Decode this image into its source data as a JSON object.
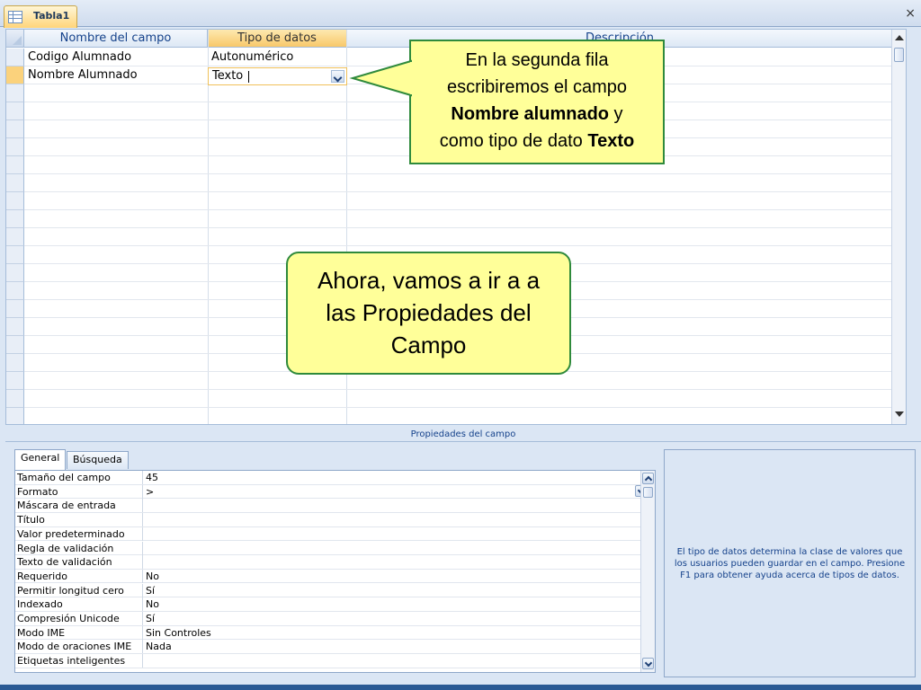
{
  "tab": {
    "label": "Tabla1",
    "close": "×",
    "icon": "table-icon"
  },
  "grid": {
    "headers": [
      "Nombre del campo",
      "Tipo de datos",
      "Descripción"
    ],
    "rows": [
      {
        "name": "Codigo Alumnado",
        "type": "Autonumérico",
        "desc": ""
      },
      {
        "name": "Nombre Alumnado",
        "type": "Texto",
        "desc": ""
      }
    ]
  },
  "callouts": {
    "top": {
      "line1": "En la segunda fila",
      "line2": "escribiremos el campo",
      "bold1": "Nombre alumnado",
      "mid": " y",
      "line4a": "como tipo de dato ",
      "bold2": "Texto"
    },
    "middle": {
      "line1": "Ahora, vamos a ir a a",
      "line2": "las Propiedades del",
      "line3": "Campo"
    }
  },
  "properties": {
    "title": "Propiedades del campo",
    "tabs": [
      "General",
      "Búsqueda"
    ],
    "rows": [
      {
        "name": "Tamaño del campo",
        "value": "45"
      },
      {
        "name": "Formato",
        "value": ">"
      },
      {
        "name": "Máscara de entrada",
        "value": ""
      },
      {
        "name": "Título",
        "value": ""
      },
      {
        "name": "Valor predeterminado",
        "value": ""
      },
      {
        "name": "Regla de validación",
        "value": ""
      },
      {
        "name": "Texto de validación",
        "value": ""
      },
      {
        "name": "Requerido",
        "value": "No"
      },
      {
        "name": "Permitir longitud cero",
        "value": "Sí"
      },
      {
        "name": "Indexado",
        "value": "No"
      },
      {
        "name": "Compresión Unicode",
        "value": "Sí"
      },
      {
        "name": "Modo IME",
        "value": "Sin Controles"
      },
      {
        "name": "Modo de oraciones IME",
        "value": "Nada"
      },
      {
        "name": "Etiquetas inteligentes",
        "value": ""
      }
    ],
    "help": "El tipo de datos determina la clase de valores que los usuarios pueden guardar en el campo. Presione F1 para obtener ayuda acerca de tipos de datos."
  }
}
